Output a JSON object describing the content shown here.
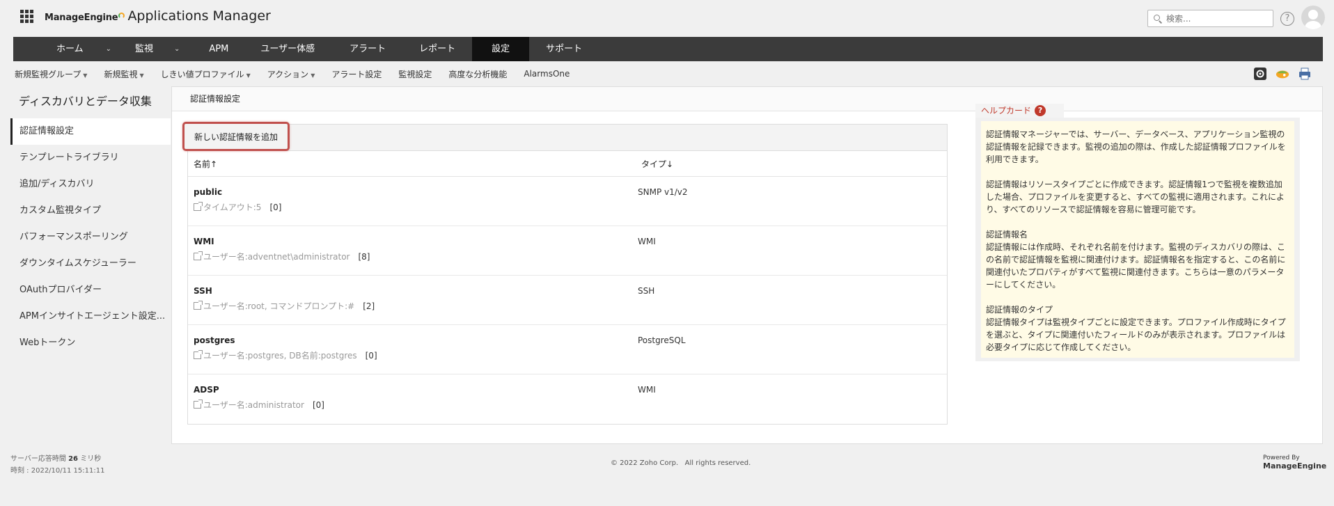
{
  "header": {
    "brand": "ManageEngine",
    "product": "Applications Manager",
    "search_placeholder": "検索..."
  },
  "mainnav": [
    {
      "label": "ホーム",
      "dropdown": true,
      "active": false
    },
    {
      "label": "監視",
      "dropdown": true,
      "active": false
    },
    {
      "label": "APM",
      "dropdown": false,
      "active": false
    },
    {
      "label": "ユーザー体感",
      "dropdown": false,
      "active": false
    },
    {
      "label": "アラート",
      "dropdown": false,
      "active": false
    },
    {
      "label": "レポート",
      "dropdown": false,
      "active": false
    },
    {
      "label": "設定",
      "dropdown": false,
      "active": true
    },
    {
      "label": "サポート",
      "dropdown": false,
      "active": false
    }
  ],
  "subnav": [
    {
      "label": "新規監視グループ",
      "dropdown": true
    },
    {
      "label": "新規監視",
      "dropdown": true
    },
    {
      "label": "しきい値プロファイル",
      "dropdown": true
    },
    {
      "label": "アクション",
      "dropdown": true
    },
    {
      "label": "アラート設定",
      "dropdown": false
    },
    {
      "label": "監視設定",
      "dropdown": false
    },
    {
      "label": "高度な分析機能",
      "dropdown": false
    },
    {
      "label": "AlarmsOne",
      "dropdown": false
    }
  ],
  "sidebar": {
    "title": "ディスカバリとデータ収集",
    "items": [
      {
        "label": "認証情報設定",
        "active": true
      },
      {
        "label": "テンプレートライブラリ",
        "active": false
      },
      {
        "label": "追加/ディスカバリ",
        "active": false
      },
      {
        "label": "カスタム監視タイプ",
        "active": false
      },
      {
        "label": "パフォーマンスポーリング",
        "active": false
      },
      {
        "label": "ダウンタイムスケジューラー",
        "active": false
      },
      {
        "label": "OAuthプロバイダー",
        "active": false
      },
      {
        "label": "APMインサイトエージェント設定...",
        "active": false
      },
      {
        "label": "Webトークン",
        "active": false
      }
    ]
  },
  "panel": {
    "title": "認証情報設定",
    "add_button": "新しい認証情報を追加",
    "col_name": "名前↑",
    "col_type": "タイプ↓",
    "rows": [
      {
        "name": "public",
        "meta": "タイムアウト:5",
        "count": "[0]",
        "type": "SNMP v1/v2"
      },
      {
        "name": "WMI",
        "meta": "ユーザー名:adventnet\\administrator",
        "count": "[8]",
        "type": "WMI"
      },
      {
        "name": "SSH",
        "meta": "ユーザー名:root, コマンドプロンプト:#",
        "count": "[2]",
        "type": "SSH"
      },
      {
        "name": "postgres",
        "meta": "ユーザー名:postgres, DB名前:postgres",
        "count": "[0]",
        "type": "PostgreSQL"
      },
      {
        "name": "ADSP",
        "meta": "ユーザー名:administrator",
        "count": "[0]",
        "type": "WMI"
      }
    ]
  },
  "helpcard": {
    "title": "ヘルプカード",
    "paragraphs": [
      "認証情報マネージャーでは、サーバー、データベース、アプリケーション監視の認証情報を記録できます。監視の追加の際は、作成した認証情報プロファイルを利用できます。",
      "認証情報はリソースタイプごとに作成できます。認証情報1つで監視を複数追加した場合、プロファイルを変更すると、すべての監視に適用されます。これにより、すべてのリソースで認証情報を容易に管理可能です。",
      "認証情報名\n認証情報には作成時、それぞれ名前を付けます。監視のディスカバリの際は、この名前で認証情報を監視に関連付けます。認証情報名を指定すると、この名前に関連付いたプロパティがすべて監視に関連付きます。こちらは一意のパラメーターにしてください。",
      "認証情報のタイプ\n認証情報タイプは監視タイプごとに設定できます。プロファイル作成時にタイプを選ぶと、タイプに関連付いたフィールドのみが表示されます。プロファイルは必要タイプに応じて作成してください。"
    ]
  },
  "footer": {
    "response_label": "サーバー応答時間",
    "response_value": "26",
    "response_unit": "ミリ秒",
    "time": "時刻 : 2022/10/11 15:11:11",
    "copyright": "© 2022 Zoho Corp.   All rights reserved.",
    "powered_by": "Powered By",
    "powered_brand": "ManageEngine"
  },
  "colors": {
    "nav_bg": "#3b3b3b",
    "nav_active": "#111111",
    "highlight": "#c0504d",
    "help_red": "#c0392b",
    "help_bg": "#fffbe6"
  }
}
